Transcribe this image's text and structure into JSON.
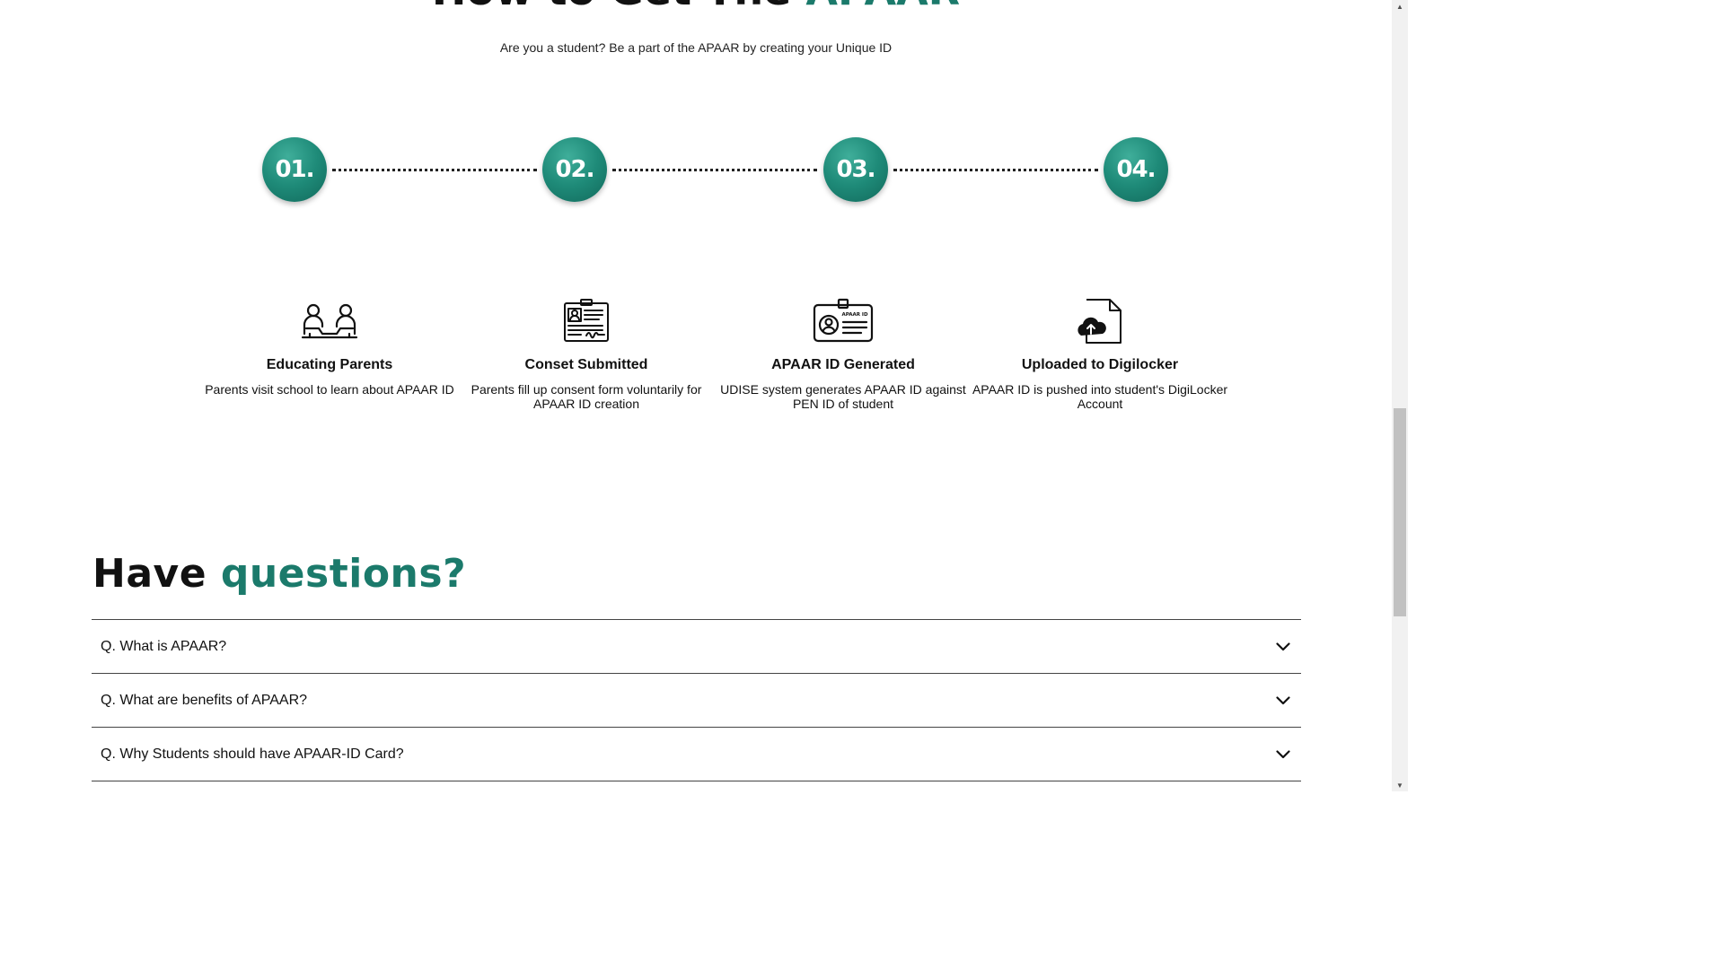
{
  "heading": {
    "prefix": "How to Get The ",
    "accent": "APAAR"
  },
  "subtitle": "Are you a student? Be a part of the APAAR by creating your Unique ID",
  "steps": [
    {
      "number": "01.",
      "icon": "parents-meeting-icon",
      "title": "Educating Parents",
      "description": "Parents visit school to learn about APAAR ID"
    },
    {
      "number": "02.",
      "icon": "consent-form-icon",
      "title": "Conset Submitted",
      "description": "Parents fill up consent form voluntarily for APAAR ID creation"
    },
    {
      "number": "03.",
      "icon": "id-card-icon",
      "title": "APAAR ID Generated",
      "description": "UDISE system generates APAAR ID against PEN ID of student"
    },
    {
      "number": "04.",
      "icon": "cloud-upload-document-icon",
      "title": "Uploaded to Digilocker",
      "description": "APAAR ID is pushed into student's DigiLocker Account"
    }
  ],
  "id_card_label": "APAAR ID",
  "faq": {
    "heading_prefix": "Have ",
    "heading_accent": "questions?",
    "items": [
      {
        "question": "Q. What is APAAR?"
      },
      {
        "question": "Q. What are benefits of APAAR?"
      },
      {
        "question": "Q. Why Students should have APAAR-ID Card?"
      }
    ]
  },
  "colors": {
    "accent": "#1b7a6b",
    "circle": "#1e8a78"
  }
}
